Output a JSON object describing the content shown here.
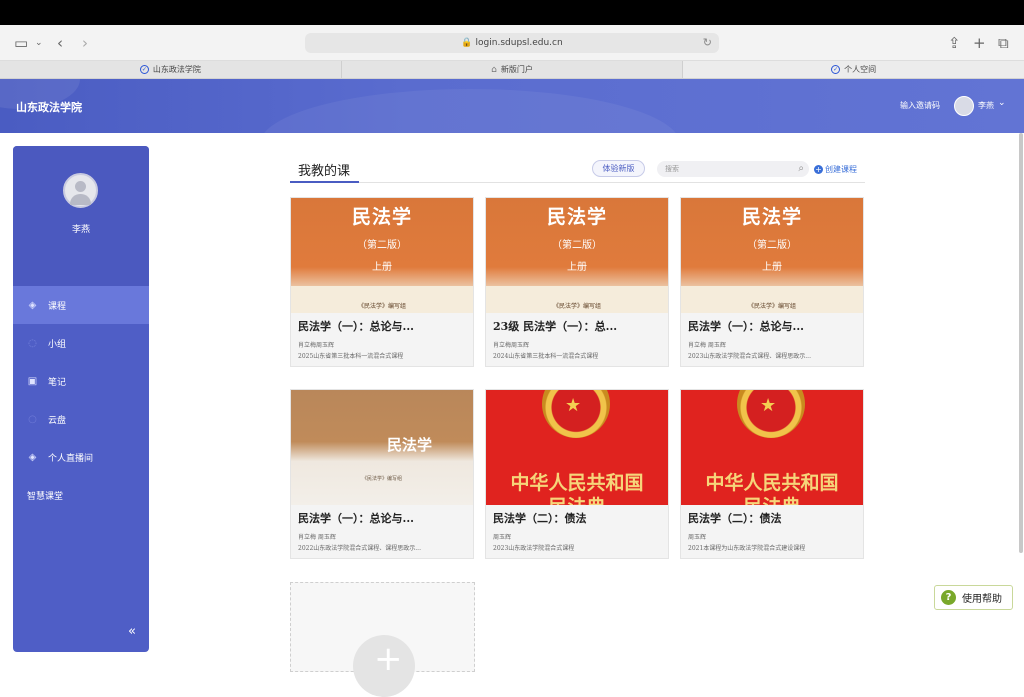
{
  "browser": {
    "url": "login.sdupsl.edu.cn",
    "tabs": [
      {
        "label": "山东政法学院"
      },
      {
        "label": "新版门户"
      },
      {
        "label": "个人空间"
      }
    ]
  },
  "header": {
    "brand": "山东政法学院",
    "invite_label": "输入邀请码",
    "user_name": "李燕"
  },
  "sidebar": {
    "name": "李燕",
    "items": [
      {
        "label": "课程",
        "icon": "course-icon",
        "active": true
      },
      {
        "label": "小组",
        "icon": "group-icon"
      },
      {
        "label": "笔记",
        "icon": "note-icon"
      },
      {
        "label": "云盘",
        "icon": "cloud-icon"
      },
      {
        "label": "个人直播间",
        "icon": "live-icon"
      },
      {
        "label": "智慧课堂"
      }
    ],
    "collapse_glyph": "«"
  },
  "main": {
    "title": "我教的课",
    "try_new_label": "体验新版",
    "search_placeholder": "搜索",
    "create_label": "创建课程",
    "courses": [
      {
        "cover": {
          "style": "orange",
          "line1": "民法学",
          "line2": "（第二版）",
          "line3": "上册",
          "line4": "《民法学》编写组"
        },
        "title": "民法学（一）：总论与...",
        "teacher": "肖立梅周玉辉",
        "desc": "2025山东省第三批本科一流混合式课程"
      },
      {
        "cover": {
          "style": "orange",
          "line1": "民法学",
          "line2": "（第二版）",
          "line3": "上册",
          "line4": "《民法学》编写组"
        },
        "title": "23级 民法学（一）：总...",
        "teacher": "肖立梅周玉辉",
        "desc": "2024山东省第三批本科一流混合式课程"
      },
      {
        "cover": {
          "style": "orange",
          "line1": "民法学",
          "line2": "（第二版）",
          "line3": "上册",
          "line4": "《民法学》编写组"
        },
        "title": "民法学（一）：总论与...",
        "teacher": "肖立梅 周玉辉",
        "desc": "2023山东政法学院混合式课程、课程思政示..."
      },
      {
        "cover": {
          "style": "brown",
          "line1": "民法学",
          "line4": "《民法学》编写组"
        },
        "title": "民法学（一）：总论与...",
        "teacher": "肖立梅 周玉辉",
        "desc": "2022山东政法学院混合式课程、课程思政示..."
      },
      {
        "cover": {
          "style": "red",
          "line1": "中华人民共和国",
          "line2": "民法典"
        },
        "title": "民法学（二）：债法",
        "teacher": "周玉辉",
        "desc": "2023山东政法学院混合式课程"
      },
      {
        "cover": {
          "style": "red",
          "line1": "中华人民共和国",
          "line2": "民法典"
        },
        "title": "民法学（二）：债法",
        "teacher": "周玉辉",
        "desc": "2021本课程为山东政法学院混合式建设课程"
      }
    ]
  },
  "help_label": "使用帮助"
}
